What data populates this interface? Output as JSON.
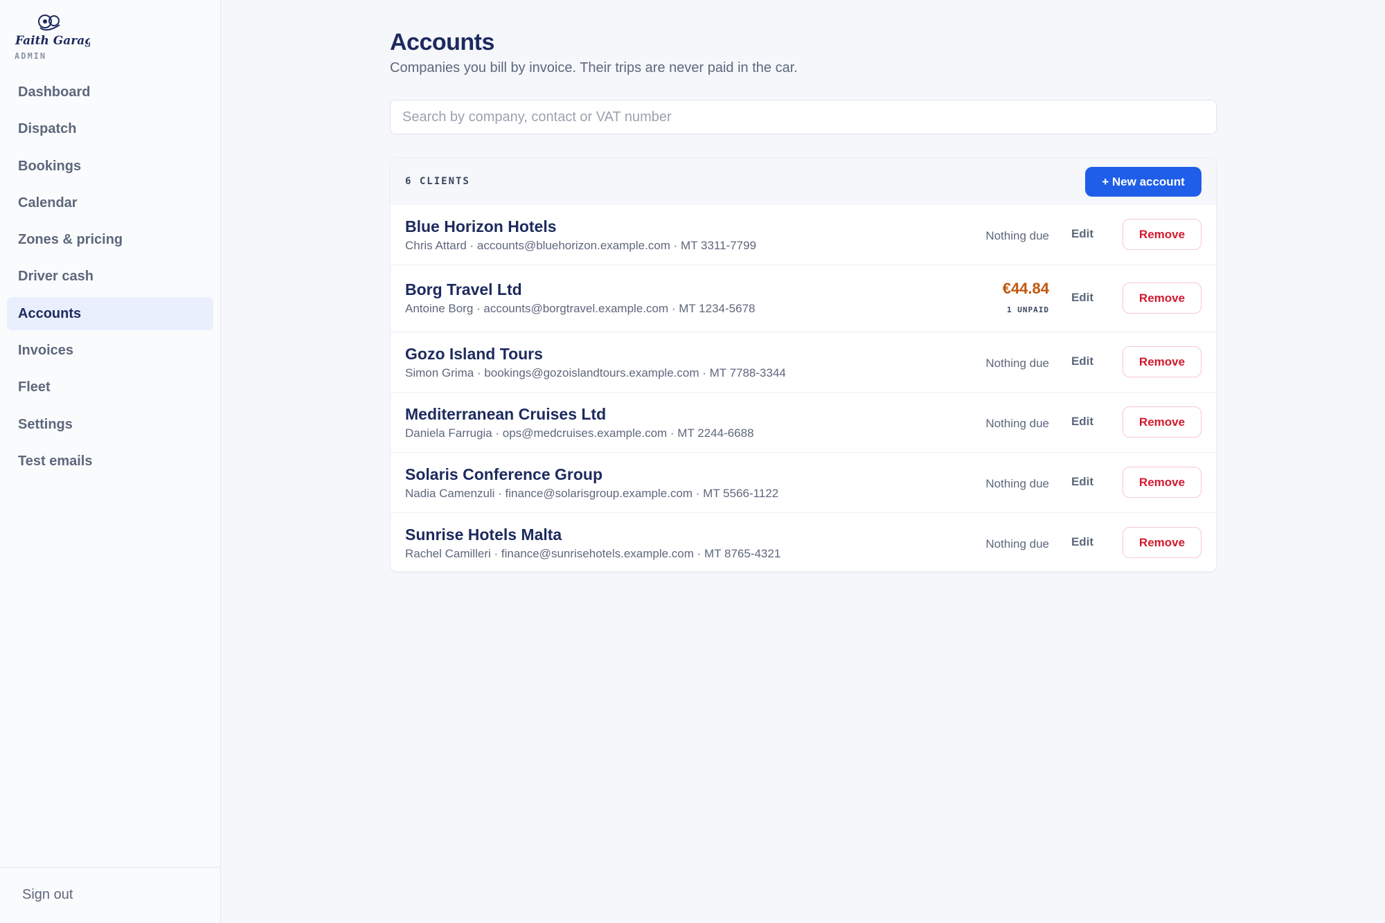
{
  "app": {
    "logo_text": "Faith Garage",
    "admin_label": "ADMIN"
  },
  "sidebar": {
    "items": [
      {
        "label": "Dashboard",
        "active": false
      },
      {
        "label": "Dispatch",
        "active": false
      },
      {
        "label": "Bookings",
        "active": false
      },
      {
        "label": "Calendar",
        "active": false
      },
      {
        "label": "Zones & pricing",
        "active": false
      },
      {
        "label": "Driver cash",
        "active": false
      },
      {
        "label": "Accounts",
        "active": true
      },
      {
        "label": "Invoices",
        "active": false
      },
      {
        "label": "Fleet",
        "active": false
      },
      {
        "label": "Settings",
        "active": false
      },
      {
        "label": "Test emails",
        "active": false
      }
    ],
    "sign_out_label": "Sign out"
  },
  "page": {
    "title": "Accounts",
    "subtitle": "Companies you bill by invoice. Their trips are never paid in the car."
  },
  "search": {
    "placeholder": "Search by company, contact or VAT number",
    "value": ""
  },
  "list": {
    "count_label": "6 CLIENTS",
    "new_button_label": "+ New account",
    "edit_label": "Edit",
    "remove_label": "Remove",
    "rows": [
      {
        "company": "Blue Horizon Hotels",
        "details": "Chris Attard · accounts@bluehorizon.example.com · MT 3311-7799",
        "status": "Nothing due"
      },
      {
        "company": "Borg Travel Ltd",
        "details": "Antoine Borg · accounts@borgtravel.example.com · MT 1234-5678",
        "due_amount": "€44.84",
        "due_count": "1 UNPAID"
      },
      {
        "company": "Gozo Island Tours",
        "details": "Simon Grima · bookings@gozoislandtours.example.com · MT 7788-3344",
        "status": "Nothing due"
      },
      {
        "company": "Mediterranean Cruises Ltd",
        "details": "Daniela Farrugia · ops@medcruises.example.com · MT 2244-6688",
        "status": "Nothing due"
      },
      {
        "company": "Solaris Conference Group",
        "details": "Nadia Camenzuli · finance@solarisgroup.example.com · MT 5566-1122",
        "status": "Nothing due"
      },
      {
        "company": "Sunrise Hotels Malta",
        "details": "Rachel Camilleri · finance@sunrisehotels.example.com · MT 8765-4321",
        "status": "Nothing due"
      }
    ]
  },
  "colors": {
    "accent": "#1f5ee8",
    "navy": "#1c2a5e",
    "due": "#c1560c",
    "danger": "#d21a2e"
  }
}
